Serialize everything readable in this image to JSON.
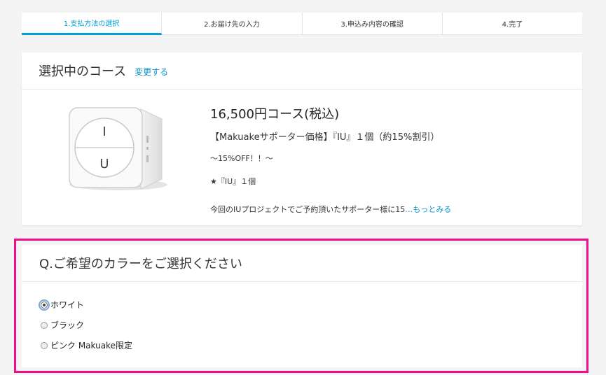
{
  "steps": [
    {
      "label": "1.支払方法の選択"
    },
    {
      "label": "2.お届け先の入力"
    },
    {
      "label": "3.申込み内容の確認"
    },
    {
      "label": "4.完了"
    }
  ],
  "course_section": {
    "title": "選択中のコース",
    "change_label": "変更する"
  },
  "course": {
    "name": "16,500円コース(税込)",
    "subtitle": "【Makuakeサポーター価格】『IU』１個（約15%割引）",
    "off_text": "〜15%OFF！！〜",
    "item_text": "★『IU』１個",
    "desc_text": "今回のIUプロジェクトでご予約頂いたサポーター様に15",
    "more_label": "…もっとみる",
    "image_top_letter": "I",
    "image_bottom_letter": "U"
  },
  "question": {
    "title": "Q.ご希望のカラーをご選択ください",
    "options": [
      {
        "label": "ホワイト",
        "checked": true
      },
      {
        "label": "ブラック",
        "checked": false
      },
      {
        "label": "ピンク Makuake限定",
        "checked": false
      }
    ]
  },
  "colors": {
    "accent": "#00a0d2",
    "link": "#0a92c7",
    "highlight": "#ec0e8b"
  }
}
